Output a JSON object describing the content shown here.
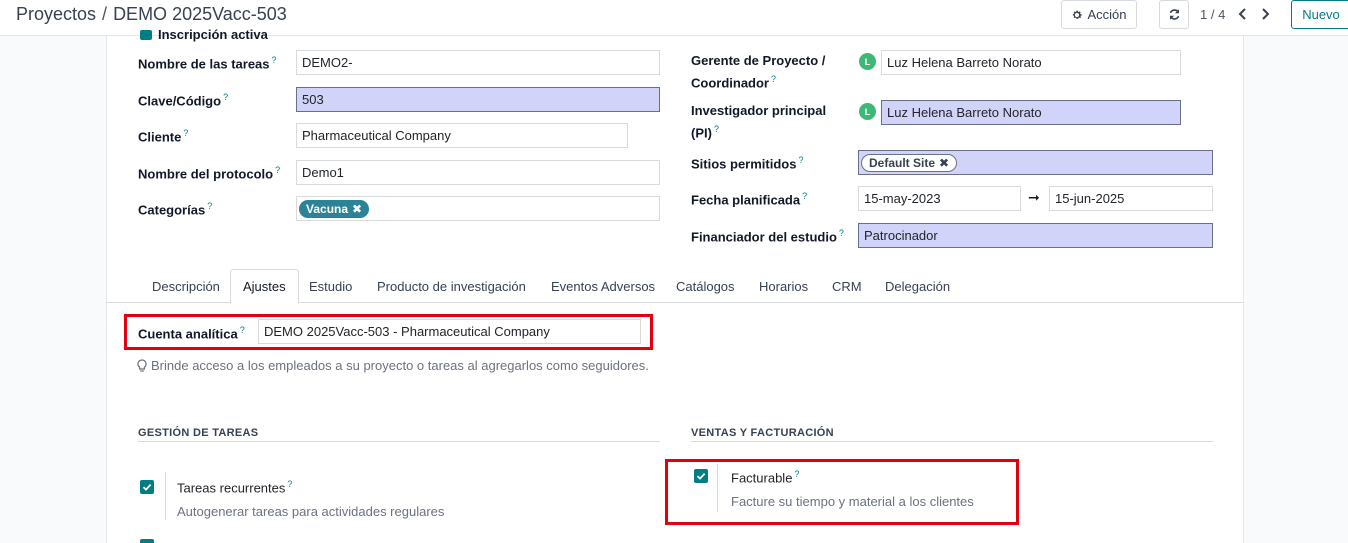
{
  "breadcrumb": {
    "parent": "Proyectos",
    "separator": "/",
    "current": "DEMO 2025Vacc-503"
  },
  "toolbar": {
    "action_label": "Acción",
    "pager": "1 / 4",
    "new_label": "Nuevo"
  },
  "partial_field": {
    "label": "Inscripción activa"
  },
  "left_fields": {
    "task_name": {
      "label": "Nombre de las tareas",
      "help": "?",
      "value": "DEMO2-"
    },
    "code": {
      "label": "Clave/Código",
      "help": "?",
      "value": "503"
    },
    "client": {
      "label": "Cliente",
      "help": "?",
      "value": "Pharmaceutical Company"
    },
    "protocol": {
      "label": "Nombre del protocolo",
      "help": "?",
      "value": "Demo1"
    },
    "categories": {
      "label": "Categorías",
      "help": "?",
      "tag": "Vacuna"
    }
  },
  "right_fields": {
    "manager": {
      "label_line1": "Gerente de Proyecto /",
      "label_line2": "Coordinador",
      "help": "?",
      "avatar": "L",
      "value": "Luz Helena Barreto Norato"
    },
    "pi": {
      "label_line1": "Investigador principal",
      "label_line2": "(PI)",
      "help": "?",
      "avatar": "L",
      "value": "Luz Helena Barreto Norato"
    },
    "sites": {
      "label": "Sitios permitidos",
      "help": "?",
      "tag": "Default Site"
    },
    "planned_date": {
      "label": "Fecha planificada",
      "help": "?",
      "start": "15-may-2023",
      "end": "15-jun-2025"
    },
    "funder": {
      "label": "Financiador del estudio",
      "help": "?",
      "value": "Patrocinador"
    }
  },
  "tabs": [
    {
      "label": "Descripción"
    },
    {
      "label": "Ajustes"
    },
    {
      "label": "Estudio"
    },
    {
      "label": "Producto de investigación"
    },
    {
      "label": "Eventos Adversos"
    },
    {
      "label": "Catálogos"
    },
    {
      "label": "Horarios"
    },
    {
      "label": "CRM"
    },
    {
      "label": "Delegación"
    }
  ],
  "active_tab": "Ajustes",
  "analytic": {
    "label": "Cuenta analítica",
    "help": "?",
    "value": "DEMO 2025Vacc-503 - Pharmaceutical Company"
  },
  "hint": "Brinde acceso a los empleados a su proyecto o tareas al agregarlos como seguidores.",
  "sections": {
    "tasks": {
      "title": "GESTIÓN DE TAREAS",
      "option_title": "Tareas recurrentes",
      "help": "?",
      "option_desc": "Autogenerar tareas para actividades regulares",
      "checked": true
    },
    "sales": {
      "title": "VENTAS Y FACTURACIÓN",
      "option_title": "Facturable",
      "help": "?",
      "option_desc": "Facture su tiempo y material a los clientes",
      "checked": true
    }
  },
  "colors": {
    "primary": "#017e84",
    "highlight_box": "#e0000f",
    "required_field": "#d2d3f8",
    "tag_vacuna": "#2c8397"
  },
  "icons": {
    "action": "gear-icon",
    "reload": "refresh-icon",
    "prev": "chevron-left-icon",
    "next": "chevron-right-icon",
    "hint": "lightbulb-icon"
  }
}
